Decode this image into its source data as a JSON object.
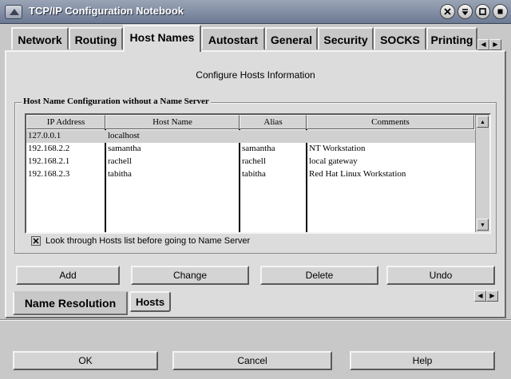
{
  "window": {
    "title": "TCP/IP Configuration Notebook",
    "controls": [
      "close-icon",
      "minimize-icon",
      "maximize-icon",
      "restore-icon"
    ]
  },
  "tabs": [
    {
      "label": "Network"
    },
    {
      "label": "Routing"
    },
    {
      "label": "Host Names",
      "active": true
    },
    {
      "label": "Autostart"
    },
    {
      "label": "General"
    },
    {
      "label": "Security"
    },
    {
      "label": "SOCKS"
    },
    {
      "label": "Printing"
    }
  ],
  "page": {
    "heading": "Configure Hosts Information",
    "group_title": "Host Name Configuration without a Name Server"
  },
  "table": {
    "columns": [
      "IP Address",
      "Host Name",
      "Alias",
      "Comments"
    ],
    "rows": [
      [
        "127.0.0.1",
        "localhost",
        "",
        ""
      ],
      [
        "192.168.2.2",
        "samantha",
        "samantha",
        "NT Workstation"
      ],
      [
        "192.168.2.1",
        "rachell",
        "rachell",
        "local gateway"
      ],
      [
        "192.168.2.3",
        "tabitha",
        "tabitha",
        "Red Hat Linux Workstation"
      ]
    ],
    "selected_row": 0
  },
  "checkbox": {
    "label": "Look through Hosts list before going to Name Server",
    "checked": true
  },
  "actions": {
    "add": "Add",
    "change": "Change",
    "delete": "Delete",
    "undo": "Undo"
  },
  "subtabs": [
    {
      "label": "Name Resolution"
    },
    {
      "label": "Hosts",
      "active": true
    }
  ],
  "footer": {
    "ok": "OK",
    "cancel": "Cancel",
    "help": "Help"
  },
  "colors": {
    "titlebar": "#7d89a2",
    "window_bg": "#c8c8c8",
    "panel_bg": "#dcdcdc",
    "selected_row": "#d0d0d0"
  }
}
